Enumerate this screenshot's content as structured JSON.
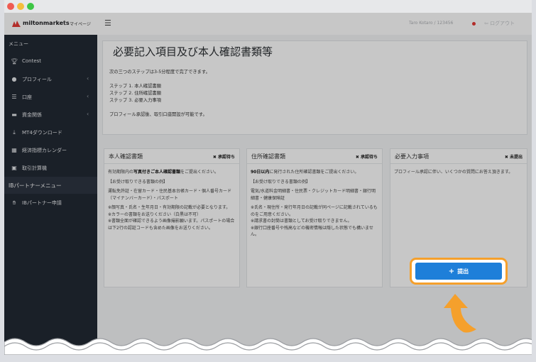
{
  "topbar": {
    "brand": "miltonmarkets",
    "brand_sep": "|",
    "brand_sub": "マイページ",
    "menu_icon": "hamburger-icon",
    "user_name": "Taro Kotaro / 123456",
    "logout_label": "ログアウト"
  },
  "sidebar": {
    "menu_header": "メニュー",
    "items": [
      {
        "label": "Contest",
        "icon": "trophy-icon",
        "chev": ""
      },
      {
        "label": "プロフィール",
        "icon": "user-icon",
        "chev": "‹"
      },
      {
        "label": "口座",
        "icon": "list-icon",
        "chev": "‹"
      },
      {
        "label": "資金関係",
        "icon": "wallet-icon",
        "chev": "‹"
      },
      {
        "label": "MT4ダウンロード",
        "icon": "download-icon",
        "chev": ""
      },
      {
        "label": "経済指標カレンダー",
        "icon": "calendar-icon",
        "chev": ""
      },
      {
        "label": "取引計算機",
        "icon": "calculator-icon",
        "chev": ""
      }
    ],
    "partner_header": "IBパートナーメニュー",
    "partner_item": "IBパートナー申請"
  },
  "intro": {
    "title": "必要記入項目及び本人確認書類等",
    "line1": "次の三つのステップは3-5分程度で完了できます。",
    "step1": "ステップ 1. 本人確認書類",
    "step2": "ステップ 2. 住所確認書類",
    "step3": "ステップ 3. 必要入力事項",
    "note": "プロフィール承認後、取引口座開設が可能です。"
  },
  "cards": {
    "identity": {
      "title": "本人確認書類",
      "status": "✖ 承認待ち",
      "p1_pre": "有効期限内の",
      "p1_bold": "写真付きご本人確認書類",
      "p1_post": "をご提出ください。",
      "p2": "【お受け取りできる書類の例】",
      "p3": "運転免許証・在留カード・住民基本台帳カード・個人番号カード（マイナンバーカード）・パスポート",
      "p4": "※顔写真・氏名・生年月日・有効期限の記載が必要となります。",
      "p5": "※カラーの書類をお送りください（白黒は不可）",
      "p6": "※書類全面が確認できるよう画像撮影願います。パスポートの場合は下2行の認証コードも含めた画像をお送りください。"
    },
    "address": {
      "title": "住所確認書類",
      "status": "✖ 承認待ち",
      "p1_bold": "90日以内",
      "p1_post": "に発行された住所確認書類をご提出ください。",
      "p2": "【お受け取りできる書類の例】",
      "p3": "電気/水道料金明細書・住民票・クレジットカード明細書・銀行明細書・健康保険証",
      "p4": "※氏名・現住所・発行年月日の記載が同ページに記載されているものをご用意ください。",
      "p5": "※請求書の封筒は書類としてお受け取りできません。",
      "p6": "※銀行口座番号や残高などの機密情報は隠した状態でも構いません。"
    },
    "required": {
      "title": "必要入力事項",
      "status": "✖ 未提出",
      "p1": "プロフィール承認に伴い、いくつかの質問にお答え頂きます。",
      "submit_label": "提出"
    }
  },
  "colors": {
    "accent_orange": "#f5a02c",
    "submit_blue": "#1e7fd9",
    "sidebar_bg": "#222934"
  }
}
